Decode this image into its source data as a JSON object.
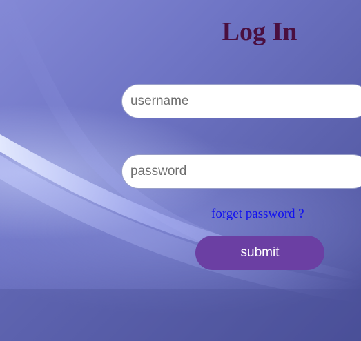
{
  "login": {
    "title": "Log In",
    "username_placeholder": "username",
    "password_placeholder": "password",
    "forget_password_label": "forget password ?",
    "submit_label": "submit"
  },
  "colors": {
    "title": "#4a0f3f",
    "link": "#1010f0",
    "submit_button": "#6b3fa3",
    "background": "#6e74c4"
  }
}
